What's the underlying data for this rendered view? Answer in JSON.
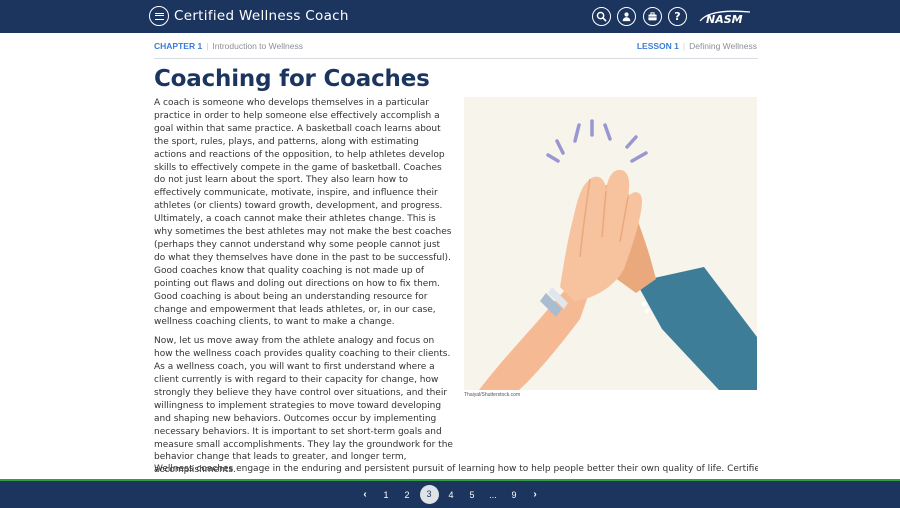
{
  "app": {
    "title": "Certified Wellness Coach",
    "logo_text": "NASM"
  },
  "breadcrumb": {
    "chapter_label": "CHAPTER 1",
    "chapter_name": "Introduction to Wellness",
    "lesson_label": "LESSON 1",
    "lesson_name": "Defining Wellness"
  },
  "page": {
    "title": "Coaching for Coaches",
    "paragraph1": "A coach is someone who develops themselves in a particular practice in order to help someone else effectively accomplish a goal within that same practice. A basketball coach learns about the sport, rules, plays, and patterns, along with estimating actions and reactions of the opposition, to help athletes develop skills to effectively compete in the game of basketball. Coaches do not just learn about the sport. They also learn how to effectively communicate, motivate, inspire, and influence their athletes (or clients) toward growth, development, and progress. Ultimately, a coach cannot make their athletes change. This is why sometimes the best athletes may not make the best coaches (perhaps they cannot understand why some people cannot just do what they themselves have done in the past to be successful). Good coaches know that quality coaching is not made up of pointing out flaws and doling out directions on how to fix them. Good coaching is about being an understanding resource for change and empowerment that leads athletes, or, in our case, wellness coaching clients, to want to make a change.",
    "paragraph2": "Now, let us move away from the athlete analogy and focus on how the wellness coach provides quality coaching to their clients. As a wellness coach, you will want to first understand where a client currently is with regard to their capacity for change, how strongly they believe they have control over situations, and their willingness to implement strategies to move toward developing and shaping new behaviors. Outcomes occur by implementing necessary behaviors. It is important to set short-term goals and measure small accomplishments. They lay the groundwork for the behavior change that leads to greater, and longer term, accomplishments.",
    "paragraph3": "Wellness coaches engage in the enduring and persistent pursuit of learning how to help people better their own quality of life. Certified Wellness",
    "image_credit": "Thaiyal/Shutterstock.com"
  },
  "pagination": {
    "prev_label": "‹",
    "next_label": "›",
    "pages": [
      "1",
      "2",
      "3",
      "4",
      "5",
      "...",
      "9"
    ],
    "current": "3"
  },
  "icons": [
    "menu-icon",
    "search-icon",
    "user-icon",
    "briefcase-icon",
    "help-icon"
  ],
  "colors": {
    "header_bg": "#1c355e",
    "accent_blue": "#3b7dd8",
    "green_line": "#2f9e44"
  }
}
